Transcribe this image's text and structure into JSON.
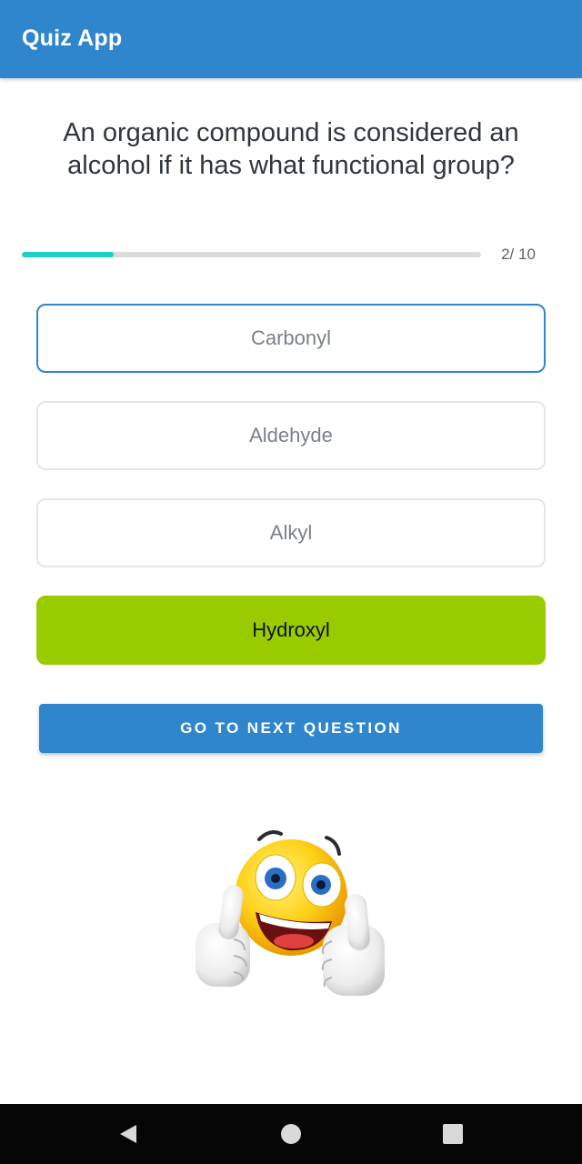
{
  "app_bar": {
    "title": "Quiz App",
    "color": "#2f86cd"
  },
  "question": {
    "text": "An organic compound is considered an alcohol if it has what functional group?"
  },
  "progress": {
    "current": 2,
    "total": 10,
    "label": "2/ 10",
    "fill_color": "#1ecfc6"
  },
  "options": [
    {
      "label": "Carbonyl",
      "state": "selected"
    },
    {
      "label": "Aldehyde",
      "state": "normal"
    },
    {
      "label": "Alkyl",
      "state": "normal"
    },
    {
      "label": "Hydroxyl",
      "state": "correct"
    }
  ],
  "colors": {
    "correct": "#99cc00",
    "selected_border": "#2f86cd"
  },
  "next_button": {
    "label": "GO TO NEXT QUESTION"
  },
  "result_image": {
    "icon": "thumbs-up-emoji-icon"
  },
  "nav": {
    "back": "back-icon",
    "home": "home-icon",
    "recent": "recent-apps-icon"
  }
}
